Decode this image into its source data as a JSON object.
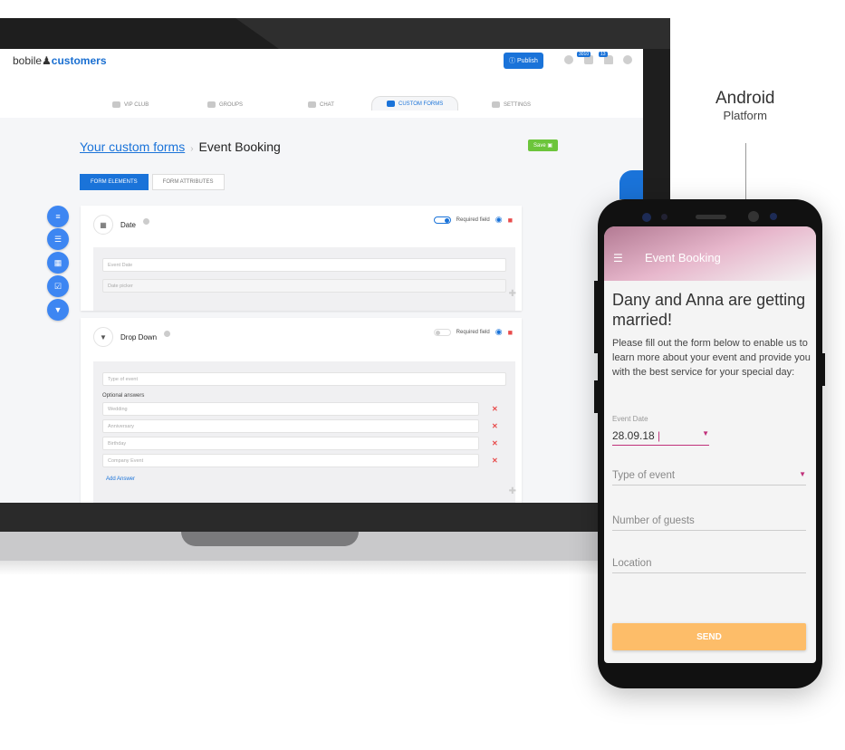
{
  "laptop": {
    "logo": {
      "part1": "bobile",
      "part2": "customers"
    },
    "header": {
      "publish_label": "Publish",
      "badge_1": "3010",
      "badge_2": "13",
      "icons": [
        "help-icon",
        "diamond-icon",
        "bell-icon",
        "gears-icon"
      ]
    },
    "tabs": [
      {
        "label": "VIP CLUB",
        "icon": "user-icon"
      },
      {
        "label": "GROUPS",
        "icon": "group-icon"
      },
      {
        "label": "CHAT",
        "icon": "chat-icon"
      },
      {
        "label": "CUSTOM FORMS",
        "icon": "form-icon",
        "active": true
      },
      {
        "label": "SETTINGS",
        "icon": "gears-icon"
      }
    ],
    "breadcrumb": {
      "link": "Your custom forms",
      "separator": "›",
      "current": "Event Booking"
    },
    "save_label": "Save",
    "form_tabs": [
      "FORM ELEMENTS",
      "FORM ATTRIBUTES"
    ],
    "sidebar_icons": [
      "text-icon",
      "paragraph-icon",
      "calendar-icon",
      "checkbox-icon",
      "dropdown-icon"
    ],
    "cards": [
      {
        "title": "Date",
        "required_label": "Required field",
        "required": true,
        "fields": [
          "Event Date",
          "Date picker"
        ]
      },
      {
        "title": "Drop Down",
        "required_label": "Required field",
        "required": false,
        "field": "Type of event",
        "answers_label": "Optional answers",
        "answers": [
          "Wedding",
          "Anniversary",
          "Birthday",
          "Company Event"
        ],
        "add_label": "Add Answer"
      }
    ],
    "accent": "#1a73d9"
  },
  "platform": {
    "name": "Android",
    "sub": "Platform"
  },
  "phone": {
    "title": "Event Booking",
    "heading": "Dany and Anna are getting married!",
    "text": "Please fill out the form below to enable us to learn more about your event and provide you with the best service for your special day:",
    "date_label": "Event Date",
    "date_value": "28.09.18",
    "fields": [
      "Type of event",
      "Number of guests",
      "Location"
    ],
    "send_label": "SEND",
    "accent": "#c0307a",
    "button_color": "#fdbd69"
  }
}
